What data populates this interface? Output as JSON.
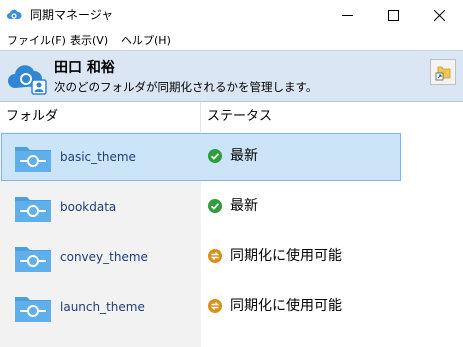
{
  "window": {
    "title": "同期マネージャ",
    "icon": "sync-cloud-icon"
  },
  "menu": {
    "items": [
      {
        "label": "ファイル(F)"
      },
      {
        "label": "表示(V)"
      },
      {
        "label": "ヘルプ(H)"
      }
    ]
  },
  "header": {
    "user_name": "田口 和裕",
    "description": "次のどのフォルダが同期化されるかを管理します。",
    "icon": "sync-cloud-user-icon",
    "action_icon": "folder-shortcut-icon"
  },
  "table": {
    "columns": [
      "フォルダ",
      "ステータス"
    ],
    "rows": [
      {
        "folder": "basic_theme",
        "status": "最新",
        "status_icon": "check-circle-icon",
        "selected": true
      },
      {
        "folder": "bookdata",
        "status": "最新",
        "status_icon": "check-circle-icon",
        "selected": false
      },
      {
        "folder": "convey_theme",
        "status": "同期化に使用可能",
        "status_icon": "sync-available-icon",
        "selected": false
      },
      {
        "folder": "launch_theme",
        "status": "同期化に使用可能",
        "status_icon": "sync-available-icon",
        "selected": false
      }
    ]
  },
  "colors": {
    "header_bg": "#dbe6f4",
    "selection_bg": "#cce4f7",
    "selection_border": "#7fb6e6",
    "folder_blue": "#4aa0e0",
    "status_ok": "#2e9e3a",
    "status_sync": "#d9901a"
  }
}
